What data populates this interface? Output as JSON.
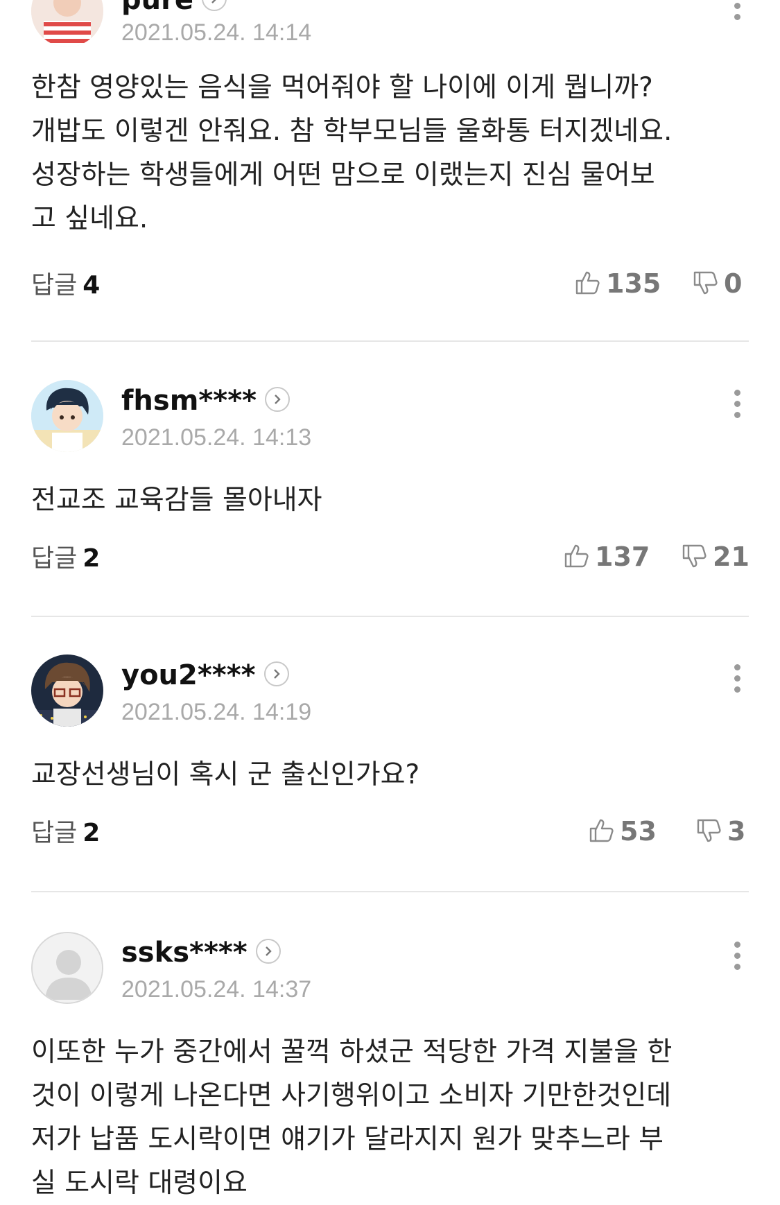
{
  "comments": [
    {
      "nickname": "pure",
      "date": "2021.05.24. 14:14",
      "text": "한참 영양있는 음식을 먹어줘야 할 나이에 이게 뭡니까?\n개밥도 이렇겐 안줘요. 참 학부모님들 울화통 터지겠네요.\n성장하는 학생들에게 어떤 맘으로 이랬는지 진심 물어보\n고 싶네요.",
      "reply_label": "답글",
      "reply_count": "4",
      "likes": "135",
      "dislikes": "0",
      "avatar": "avatar-woman-red-stripes"
    },
    {
      "nickname": "fhsm****",
      "date": "2021.05.24. 14:13",
      "text": "전교조 교육감들 몰아내자",
      "reply_label": "답글",
      "reply_count": "2",
      "likes": "137",
      "dislikes": "21",
      "avatar": "avatar-cartoon-boy"
    },
    {
      "nickname": "you2****",
      "date": "2021.05.24. 14:19",
      "text": "교장선생님이 혹시 군 출신인가요?",
      "reply_label": "답글",
      "reply_count": "2",
      "likes": "53",
      "dislikes": "3",
      "avatar": "avatar-cartoon-glasses"
    },
    {
      "nickname": "ssks****",
      "date": "2021.05.24. 14:37",
      "text": "이또한 누가 중간에서 꿀꺽 하셨군 적당한 가격 지불을 한\n것이 이렇게 나온다면 사기행위이고 소비자 기만한것인데\n저가 납품 도시락이면 얘기가 달라지지 원가 맞추느라 부\n실 도시락 대령이요",
      "avatar": "avatar-default-placeholder"
    }
  ],
  "icons": {
    "like": "thumbs-up-icon",
    "dislike": "thumbs-down-icon",
    "more": "more-vertical-icon",
    "profile": "chevron-right-icon"
  },
  "colors": {
    "date": "#a9a9a9",
    "divider": "#e6e6e6",
    "vote": "#777777"
  }
}
